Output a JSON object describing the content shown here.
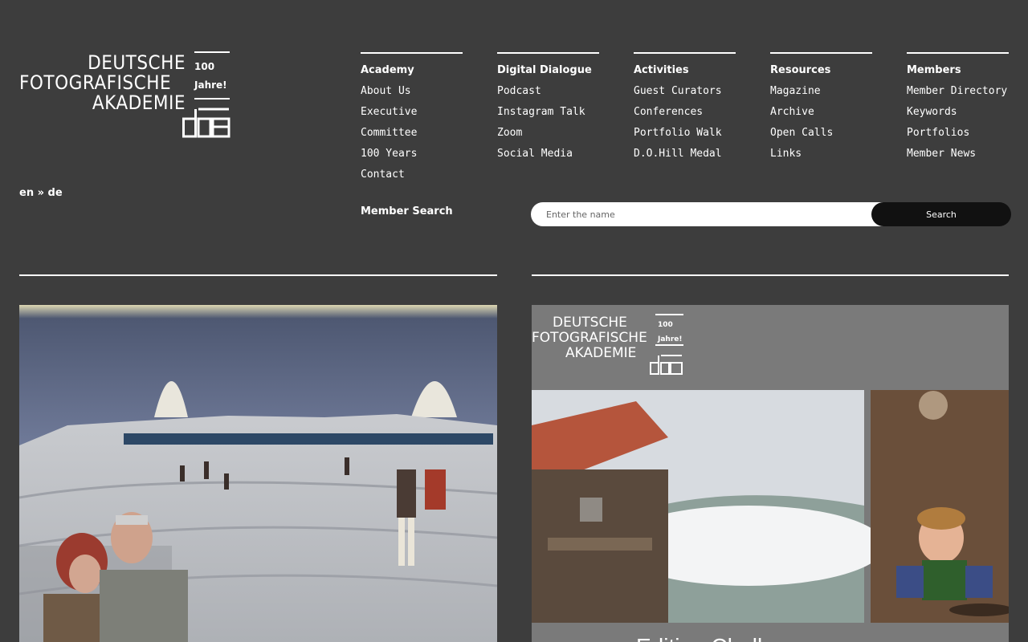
{
  "logo": {
    "line1": "DEUTSCHE",
    "line2": "FOTOGRAFISCHE",
    "line3": "AKADEMIE",
    "badge_line1": "100",
    "badge_line2": "Jahre!"
  },
  "language": {
    "en": "en",
    "separator": " » ",
    "de": "de"
  },
  "nav": [
    {
      "heading": "Academy",
      "items": [
        "About Us",
        "Executive",
        "Committee",
        "100 Years",
        "Contact"
      ]
    },
    {
      "heading": "Digital Dialogue",
      "items": [
        "Podcast",
        "Instagram Talk",
        "Zoom",
        "Social Media"
      ]
    },
    {
      "heading": "Activities",
      "items": [
        "Guest Curators",
        "Conferences",
        "Portfolio Walk",
        "D.O.Hill Medal"
      ]
    },
    {
      "heading": "Resources",
      "items": [
        "Magazine",
        "Archive",
        "Open Calls",
        "Links"
      ]
    },
    {
      "heading": "Members",
      "items": [
        "Member Directory",
        "Keywords",
        "Portfolios",
        "Member News"
      ]
    }
  ],
  "member_search": {
    "label": "Member Search",
    "placeholder": "Enter the name",
    "button": "Search"
  },
  "cards": [
    {
      "image": "photo-christo-wrapped-landscape"
    },
    {
      "image": "editing-challenge-poster",
      "logo_line1": "DEUTSCHE",
      "logo_line2": "FOTOGRAFISCHE",
      "logo_line3": "AKADEMIE",
      "logo_badge1": "100",
      "logo_badge2": "Jahre!",
      "caption": "Editing Challenge"
    }
  ]
}
